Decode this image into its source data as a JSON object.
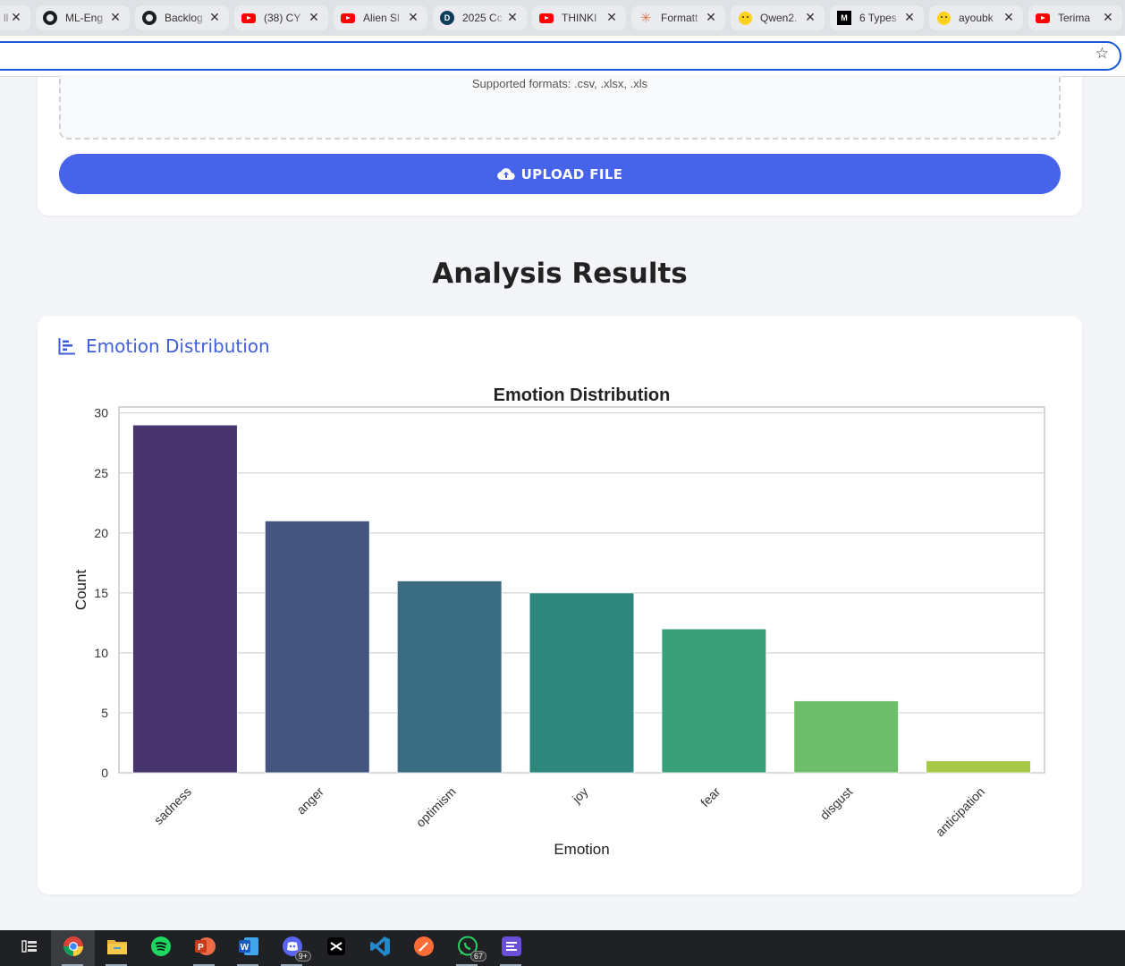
{
  "browser": {
    "tabs": [
      {
        "title": "llı",
        "icon": "generic-icon"
      },
      {
        "title": "ML-Eng",
        "icon": "github-icon"
      },
      {
        "title": "Backlog",
        "icon": "github-icon"
      },
      {
        "title": "(38) CY",
        "icon": "youtube-icon"
      },
      {
        "title": "Alien Sl",
        "icon": "youtube-icon"
      },
      {
        "title": "2025 Cc",
        "icon": "d-logo-icon"
      },
      {
        "title": "THINKI",
        "icon": "youtube-icon"
      },
      {
        "title": "Formatt",
        "icon": "claude-icon"
      },
      {
        "title": "Qwen2.",
        "icon": "huggingface-icon"
      },
      {
        "title": "6 Types",
        "icon": "medium-icon"
      },
      {
        "title": "ayoubk",
        "icon": "huggingface-icon"
      },
      {
        "title": "Terima",
        "icon": "youtube-icon"
      }
    ],
    "close_glyph": "✕",
    "bookmark_icon": "star-icon"
  },
  "upload": {
    "formats_text": "Supported formats: .csv, .xlsx, .xls",
    "button_label": "UPLOAD FILE"
  },
  "results": {
    "section_title": "Analysis Results",
    "card_title": "Emotion Distribution"
  },
  "chart_data": {
    "type": "bar",
    "title": "Emotion Distribution",
    "xlabel": "Emotion",
    "ylabel": "Count",
    "categories": [
      "sadness",
      "anger",
      "optimism",
      "joy",
      "fear",
      "disgust",
      "anticipation"
    ],
    "values": [
      29,
      21,
      16,
      15,
      12,
      6,
      1
    ],
    "ylim": [
      0,
      30
    ],
    "yticks": [
      0,
      5,
      10,
      15,
      20,
      25,
      30
    ],
    "colors": [
      "#48356f",
      "#44557f",
      "#3a6d82",
      "#2e877d",
      "#3aa07b",
      "#6dbd6b",
      "#a5c947"
    ],
    "grid": true,
    "legend": "none"
  },
  "taskbar": {
    "apps": [
      "task-view-icon",
      "chrome-icon",
      "file-explorer-icon",
      "spotify-icon",
      "powerpoint-icon",
      "word-icon",
      "discord-icon",
      "capcut-icon",
      "vscode-icon",
      "postman-icon",
      "whatsapp-icon",
      "notes-app-icon"
    ],
    "discord_badge": "9+",
    "whatsapp_badge": "67"
  }
}
